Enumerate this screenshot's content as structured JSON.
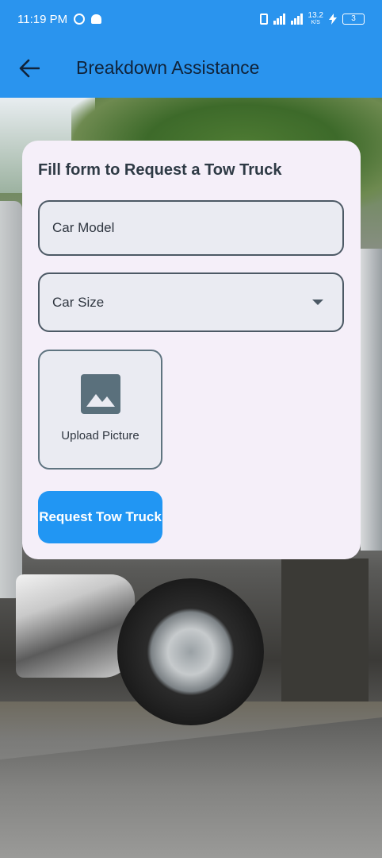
{
  "status_bar": {
    "time": "11:19 PM",
    "network_speed": "13.2",
    "network_unit": "K/S",
    "battery": "3"
  },
  "app_bar": {
    "title": "Breakdown Assistance",
    "back_icon": "arrow-back-icon"
  },
  "form": {
    "title": "Fill form to Request a Tow Truck",
    "car_model_placeholder": "Car Model",
    "car_size_placeholder": "Car Size",
    "upload_label": "Upload Picture",
    "upload_icon": "image-icon",
    "submit_label": "Request Tow Truck"
  },
  "colors": {
    "app_bar": "#2a94ee",
    "card": "#f5eff9",
    "button": "#2196f3",
    "field_border": "#4c5965"
  }
}
